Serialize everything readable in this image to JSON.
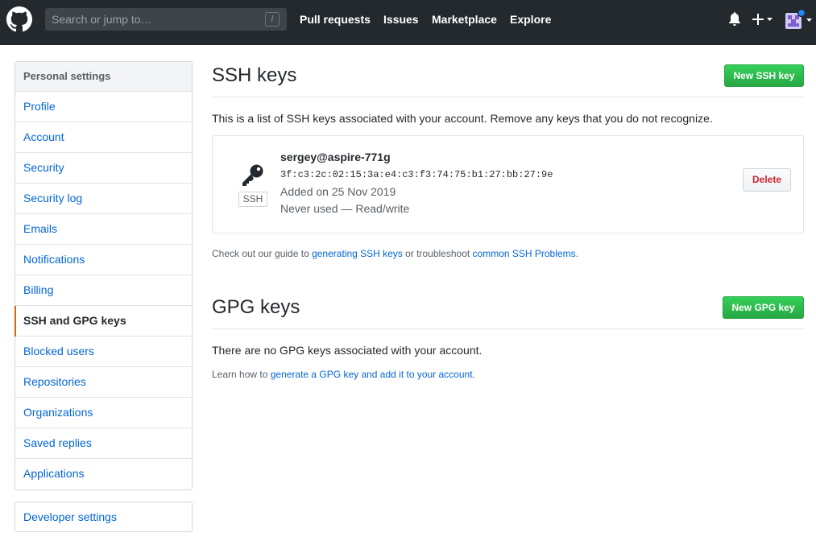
{
  "header": {
    "logo_icon": "github-octocat-icon",
    "search_placeholder": "Search or jump to…",
    "search_shortcut": "/",
    "nav": [
      "Pull requests",
      "Issues",
      "Marketplace",
      "Explore"
    ],
    "bell_icon": "bell-icon",
    "plus_icon": "plus-dropdown-icon",
    "avatar_icon": "user-avatar-icon"
  },
  "sidebar": {
    "heading": "Personal settings",
    "items": [
      {
        "label": "Profile"
      },
      {
        "label": "Account"
      },
      {
        "label": "Security"
      },
      {
        "label": "Security log"
      },
      {
        "label": "Emails"
      },
      {
        "label": "Notifications"
      },
      {
        "label": "Billing"
      },
      {
        "label": "SSH and GPG keys",
        "selected": true
      },
      {
        "label": "Blocked users"
      },
      {
        "label": "Repositories"
      },
      {
        "label": "Organizations"
      },
      {
        "label": "Saved replies"
      },
      {
        "label": "Applications"
      }
    ],
    "developer_settings": "Developer settings"
  },
  "ssh": {
    "title": "SSH keys",
    "new_button": "New SSH key",
    "description": "This is a list of SSH keys associated with your account. Remove any keys that you do not recognize.",
    "key": {
      "icon": "key-icon",
      "tag": "SSH",
      "title": "sergey@aspire-771g",
      "fingerprint": "3f:c3:2c:02:15:3a:e4:c3:f3:74:75:b1:27:bb:27:9e",
      "added": "Added on 25 Nov 2019",
      "usage": "Never used — Read/write",
      "delete_label": "Delete"
    },
    "guide": {
      "prefix": "Check out our guide to ",
      "link1": "generating SSH keys",
      "middle": " or troubleshoot ",
      "link2": "common SSH Problems",
      "suffix": "."
    }
  },
  "gpg": {
    "title": "GPG keys",
    "new_button": "New GPG key",
    "empty": "There are no GPG keys associated with your account.",
    "learn": {
      "prefix": "Learn how to ",
      "link": "generate a GPG key and add it to your account",
      "suffix": "."
    }
  },
  "colors": {
    "header_bg": "#24292e",
    "link": "#0366d6",
    "green": "#28a745",
    "danger": "#cb2431",
    "selected_accent": "#e36209"
  }
}
